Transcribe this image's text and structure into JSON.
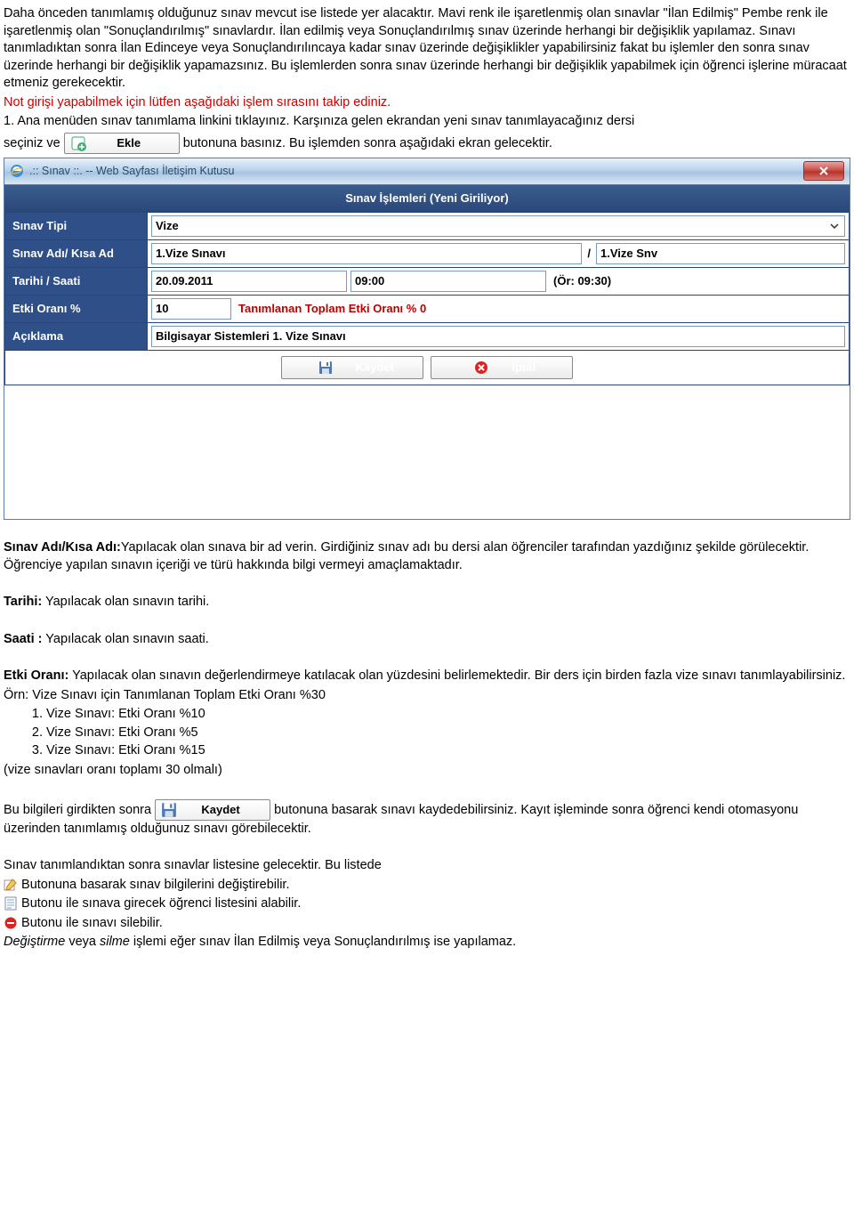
{
  "intro": {
    "p1": "Daha önceden tanımlamış olduğunuz sınav mevcut ise listede yer alacaktır. Mavi renk ile işaretlenmiş olan sınavlar \"İlan Edilmiş\" Pembe renk ile işaretlenmiş olan \"Sonuçlandırılmış\" sınavlardır. İlan edilmiş veya Sonuçlandırılmış sınav üzerinde herhangi bir değişiklik yapılamaz. Sınavı tanımladıktan sonra İlan Edinceye veya Sonuçlandırılıncaya kadar sınav üzerinde değişiklikler yapabilirsiniz fakat bu işlemler den sonra sınav üzerinde herhangi bir değişiklik yapamazsınız. Bu işlemlerden sonra sınav üzerinde herhangi bir değişiklik yapabilmek için öğrenci işlerine müracaat etmeniz gerekecektir.",
    "red": "Not girişi yapabilmek için lütfen aşağıdaki işlem sırasını takip ediniz.",
    "list1": "1.  Ana menüden sınav tanımlama linkini tıklayınız. Karşınıza gelen ekrandan yeni sınav tanımlayacağınız dersi",
    "list1_a": "seçiniz ve ",
    "list1_b": " butonuna basınız. Bu işlemden sonra aşağıdaki ekran gelecektir.",
    "ekle_label": "Ekle"
  },
  "dialog": {
    "window_title": ".:: Sınav ::. -- Web Sayfası İletişim Kutusu",
    "header": "Sınav İşlemleri (Yeni Giriliyor)",
    "labels": {
      "tip": "Sınav Tipi",
      "ad": "Sınav Adı/ Kısa Ad",
      "tarih": "Tarihi / Saati",
      "etki": "Etki Oranı %",
      "aciklama": "Açıklama"
    },
    "values": {
      "tip": "Vize",
      "ad": "1.Vize Sınavı",
      "kisa": "1.Vize Snv",
      "tarih": "20.09.2011",
      "saat": "09:00",
      "saat_hint": "(Ör: 09:30)",
      "etki": "10",
      "etki_red": "Tanımlanan Toplam Etki Oranı %  0",
      "aciklama": "Bilgisayar Sistemleri 1. Vize Sınavı"
    },
    "buttons": {
      "kaydet": "Kaydet",
      "iptal": "İptal"
    }
  },
  "after": {
    "sinav_ad_lbl": "Sınav Adı/Kısa Adı:",
    "sinav_ad_txt": "Yapılacak olan sınava bir ad verin. Girdiğiniz sınav adı bu dersi alan öğrenciler tarafından yazdığınız şekilde görülecektir. Öğrenciye yapılan sınavın içeriği ve türü hakkında bilgi vermeyi amaçlamaktadır.",
    "tarih_lbl": "Tarihi:",
    "tarih_txt": " Yapılacak olan sınavın tarihi.",
    "saat_lbl": "Saati :",
    "saat_txt": " Yapılacak olan sınavın saati.",
    "etki_lbl": "Etki Oranı:",
    "etki_txt": "  Yapılacak olan sınavın değerlendirmeye katılacak olan yüzdesini belirlemektedir. Bir ders için birden fazla vize sınavı tanımlayabilirsiniz.",
    "orn": "Örn:    Vize Sınavı için Tanımlanan Toplam Etki Oranı %30",
    "li1": "Vize Sınavı: Etki Oranı %10",
    "li2": "Vize Sınavı: Etki Oranı %5",
    "li3": "Vize Sınavı: Etki Oranı %15",
    "sumline": "(vize sınavları oranı toplamı 30 olmalı)",
    "kaydet_a": "Bu bilgileri girdikten sonra",
    "kaydet_btn": "Kaydet",
    "kaydet_b": "butonuna basarak sınavı kaydedebilirsiniz. Kayıt işleminde sonra öğrenci kendi otomasyonu üzerinden tanımlamış olduğunuz sınavı görebilecektir.",
    "liste": "Sınav tanımlandıktan sonra sınavlar listesine gelecektir. Bu listede",
    "b1": " Butonuna basarak sınav bilgilerini değiştirebilir.",
    "b2": " Butonu ile sınava girecek öğrenci listesini alabilir.",
    "b3": " Butonu ile sınavı silebilir.",
    "last_a": "Değiştirme",
    "last_b": "  veya ",
    "last_c": "silme",
    "last_d": "  işlemi eğer sınav İlan Edilmiş veya Sonuçlandırılmış ise yapılamaz."
  }
}
